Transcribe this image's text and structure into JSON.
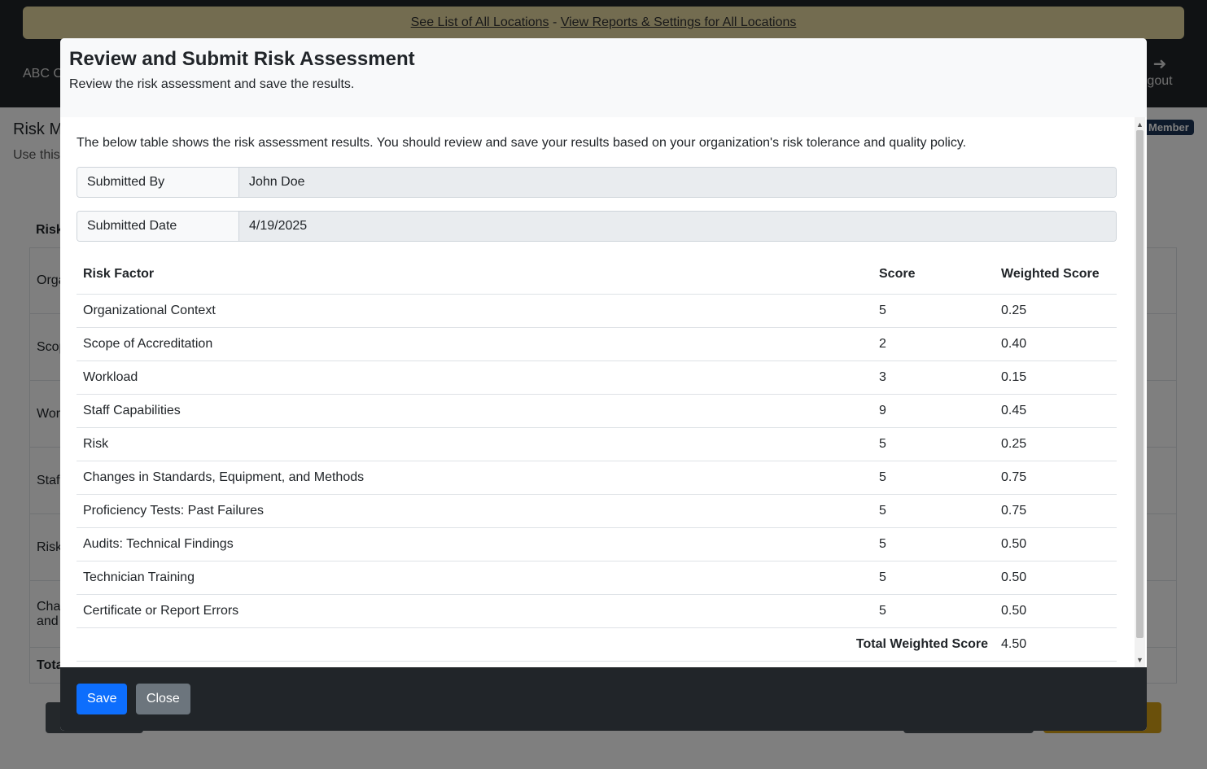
{
  "banner": {
    "link_all_locations": "See List of All Locations",
    "separator": " - ",
    "link_reports": "View Reports & Settings for All Locations"
  },
  "nav": {
    "brand_partial": "ABC C",
    "logout_partial": "gout"
  },
  "background": {
    "page_title_partial": "Risk M",
    "page_sub_partial": "Use this",
    "badge": "Member",
    "table_head_partial": "Risk",
    "rows_partial": [
      "Orga",
      "Scop",
      "Wor",
      "Staf",
      "Risk",
      "Cha\nand"
    ],
    "total_partial": "Tota"
  },
  "modal": {
    "title": "Review and Submit Risk Assessment",
    "subtitle": "Review the risk assessment and save the results.",
    "intro": "The below table shows the risk assessment results. You should review and save your results based on your organization's risk tolerance and quality policy.",
    "submitted_by_label": "Submitted By",
    "submitted_by_value": "John Doe",
    "submitted_date_label": "Submitted Date",
    "submitted_date_value": "4/19/2025",
    "table": {
      "headers": [
        "Risk Factor",
        "Score",
        "Weighted Score"
      ],
      "rows": [
        [
          "Organizational Context",
          "5",
          "0.25"
        ],
        [
          "Scope of Accreditation",
          "2",
          "0.40"
        ],
        [
          "Workload",
          "3",
          "0.15"
        ],
        [
          "Staff Capabilities",
          "9",
          "0.45"
        ],
        [
          "Risk",
          "5",
          "0.25"
        ],
        [
          "Changes in Standards, Equipment, and Methods",
          "5",
          "0.75"
        ],
        [
          "Proficiency Tests: Past Failures",
          "5",
          "0.75"
        ],
        [
          "Audits: Technical Findings",
          "5",
          "0.50"
        ],
        [
          "Technician Training",
          "5",
          "0.50"
        ],
        [
          "Certificate or Report Errors",
          "5",
          "0.50"
        ]
      ],
      "total_label": "Total Weighted Score",
      "total_value": "4.50"
    },
    "save_label": "Save",
    "close_label": "Close"
  }
}
